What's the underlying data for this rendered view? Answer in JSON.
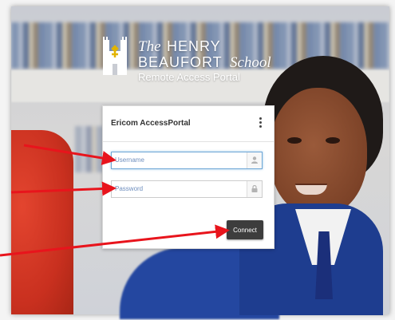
{
  "logo": {
    "the": "The",
    "henry": "HENRY",
    "beaufort": "BEAUFORT",
    "school": "School",
    "portal": "Remote Access Portal"
  },
  "panel": {
    "title": "Ericom AccessPortal",
    "menu_icon": "vertical-ellipsis-icon"
  },
  "form": {
    "username_placeholder": "Username",
    "password_placeholder": "Password",
    "username_icon": "user-icon",
    "password_icon": "lock-icon",
    "connect_label": "Connect"
  },
  "colors": {
    "arrow": "#e8141c",
    "button": "#3d3d3d",
    "focus": "#6fa7d6"
  }
}
